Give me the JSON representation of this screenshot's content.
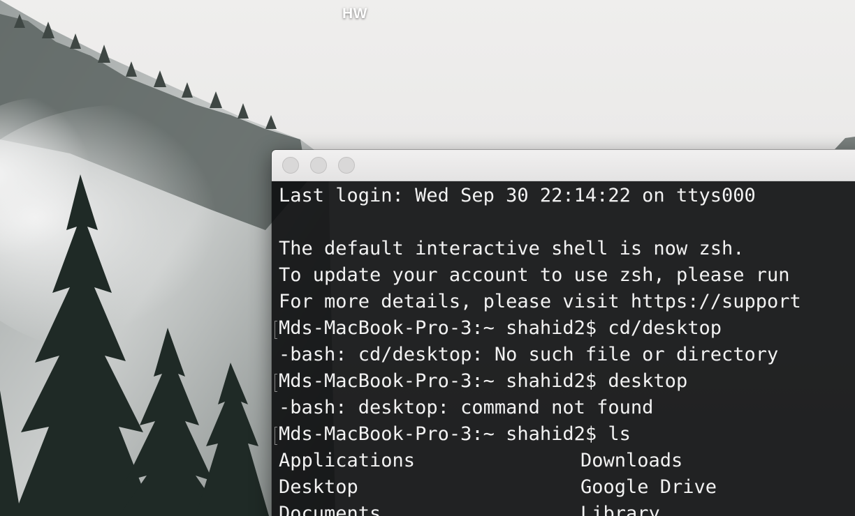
{
  "desktop": {
    "icon_label": "HW"
  },
  "terminal": {
    "lines": [
      {
        "text": "Last login: Wed Sep 30 22:14:22 on ttys000",
        "prompt": false
      },
      {
        "text": "",
        "prompt": false
      },
      {
        "text": "The default interactive shell is now zsh.",
        "prompt": false
      },
      {
        "text": "To update your account to use zsh, please run",
        "prompt": false
      },
      {
        "text": "For more details, please visit https://support",
        "prompt": false
      },
      {
        "text": "Mds-MacBook-Pro-3:~ shahid2$ cd/desktop",
        "prompt": true
      },
      {
        "text": "-bash: cd/desktop: No such file or directory",
        "prompt": false
      },
      {
        "text": "Mds-MacBook-Pro-3:~ shahid2$ desktop",
        "prompt": true
      },
      {
        "text": "-bash: desktop: command not found",
        "prompt": false
      },
      {
        "text": "Mds-MacBook-Pro-3:~ shahid2$ ls",
        "prompt": true
      }
    ],
    "listing": [
      {
        "left": "Applications",
        "right": "Downloads"
      },
      {
        "left": "Desktop",
        "right": "Google Drive"
      },
      {
        "left": "Documents",
        "right": "Library"
      }
    ]
  },
  "colors": {
    "terminal_bg": "#0c0d0e",
    "terminal_fg": "#f2f2f2",
    "titlebar": "#e8e7e7"
  }
}
